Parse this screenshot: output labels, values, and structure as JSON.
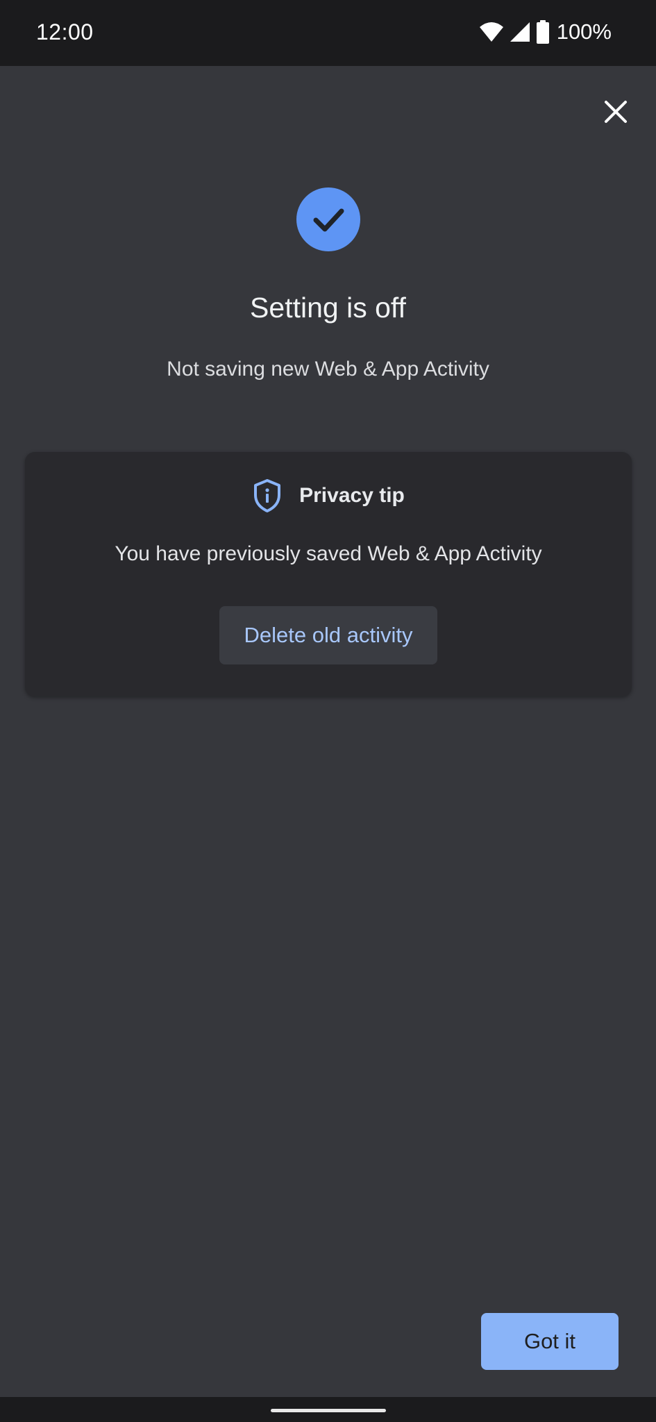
{
  "status_bar": {
    "time": "12:00",
    "battery": "100%",
    "icons": [
      "wifi-icon",
      "signal-icon",
      "battery-icon"
    ]
  },
  "dialog": {
    "close_icon": "close-icon",
    "status_icon": "check-circle-icon",
    "title": "Setting is off",
    "subtitle": "Not saving new Web & App Activity"
  },
  "privacy_tip": {
    "icon": "shield-info-icon",
    "title": "Privacy tip",
    "body": "You have previously saved Web & App Activity",
    "button_label": "Delete old activity"
  },
  "footer": {
    "confirm_label": "Got it"
  },
  "colors": {
    "background": "#36373c",
    "card": "#29292d",
    "accent": "#8ab4f8",
    "check_circle": "#5e95f4",
    "link_text": "#a8c7fa"
  }
}
